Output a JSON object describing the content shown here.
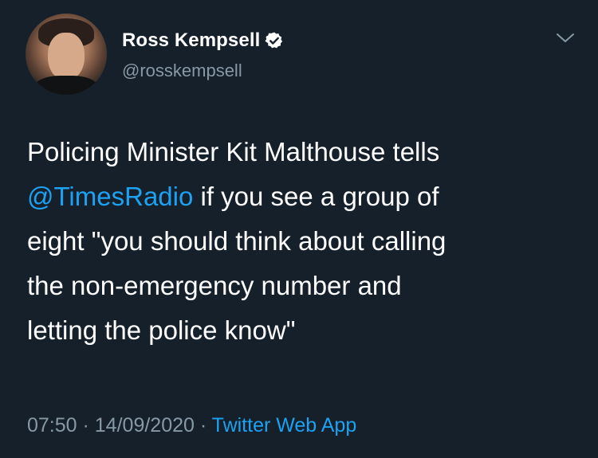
{
  "user": {
    "display_name": "Ross Kempsell",
    "handle": "@rosskempsell",
    "verified": true
  },
  "tweet": {
    "line1": "Policing Minister Kit Malthouse tells",
    "mention": "@TimesRadio",
    "line2_rest": " if you see a group of",
    "line3": "eight \"you should think about calling",
    "line4": "the non-emergency number and",
    "line5": "letting the police know\""
  },
  "meta": {
    "time": "07:50",
    "separator1": " · ",
    "date": "14/09/2020",
    "separator2": " · ",
    "source": "Twitter Web App"
  },
  "colors": {
    "background": "#15202b",
    "accent": "#1da1f2",
    "secondary_text": "#8899a6"
  },
  "icons": {
    "verified": "verified-badge-icon",
    "menu": "chevron-down-icon"
  }
}
